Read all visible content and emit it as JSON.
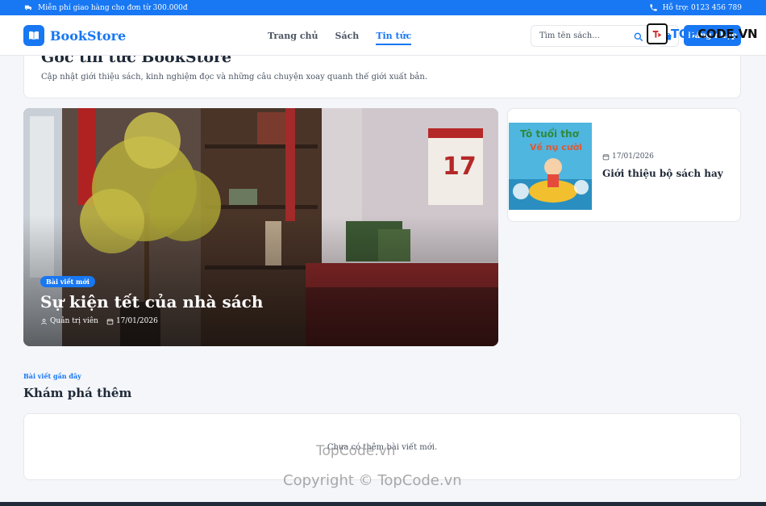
{
  "topbar": {
    "shipping": "Miễn phí giao hàng cho đơn từ 300.000đ",
    "support": "Hỗ trợ: 0123 456 789"
  },
  "header": {
    "brand": "BookStore",
    "nav": [
      {
        "label": "Trang chủ"
      },
      {
        "label": "Sách"
      },
      {
        "label": "Tin tức",
        "active": true
      }
    ],
    "search_placeholder": "Tìm tên sách...",
    "login": "Đăng nhập",
    "watermark_logo": {
      "prefix": "TOP",
      "suffix": "CODE.VN"
    }
  },
  "intro": {
    "title": "Góc tin tức BookStore",
    "subtitle": "Cập nhật giới thiệu sách, kinh nghiệm đọc và những câu chuyện xoay quanh thế giới xuất bản."
  },
  "featured": {
    "badge": "Bài viết mới",
    "title": "Sự kiện tết của nhà sách",
    "author": "Quản trị viên",
    "date": "17/01/2026"
  },
  "side_post": {
    "date": "17/01/2026",
    "title": "Giới thiệu bộ sách hay",
    "thumb_text": "Tô tuổi thơ Về nụ cười"
  },
  "recent": {
    "kicker": "Bài viết gần đây",
    "title": "Khám phá thêm",
    "empty": "Chưa có thêm bài viết mới."
  },
  "watermarks": [
    "TopCode.vn",
    "Copyright © TopCode.vn"
  ],
  "colors": {
    "accent": "#1877f2",
    "text": "#1f2937",
    "muted": "#4b5563"
  }
}
